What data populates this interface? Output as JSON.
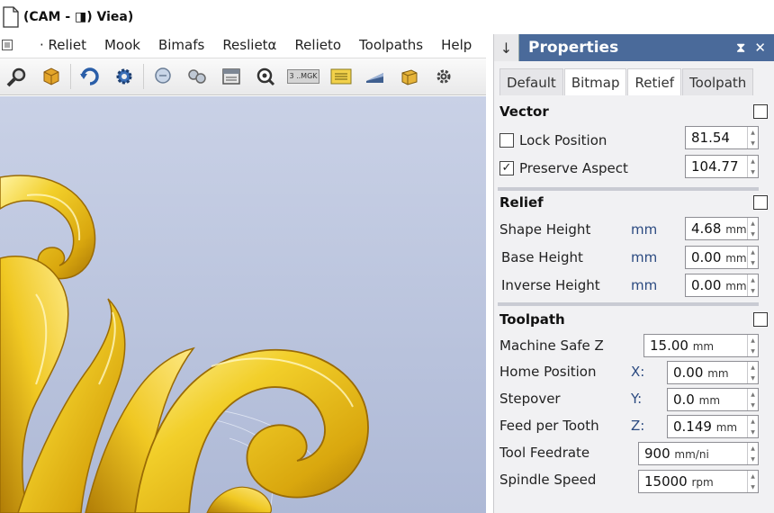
{
  "window": {
    "title": "(CAM - ◨) Viea)"
  },
  "menu": {
    "items": [
      "· Reliet",
      "Mook",
      "Bimafs",
      "Reslietα",
      "Relieto",
      "Toolpaths",
      "Help"
    ]
  },
  "toolbar": {
    "stamp_label": "3 ..MGK"
  },
  "panel": {
    "title": "Properties",
    "pin_glyph": "↓",
    "pin_ctrl": "⧗",
    "close_ctrl": "✕",
    "tabs": [
      "Default",
      "Bitmap",
      "Retief",
      "Toolpath"
    ],
    "vector": {
      "title": "Vector",
      "lock_label": "Lock Position",
      "lock_value": "81.54",
      "preserve_label": "Preserve Aspect",
      "preserve_check": "✓",
      "preserve_value": "104.77"
    },
    "relief": {
      "title": "Relief",
      "rows": [
        {
          "label": "Shape Height",
          "unit": "mm",
          "value": "4.68",
          "value_unit": "mm"
        },
        {
          "label": "Base Height",
          "unit": "mm",
          "value": "0.00",
          "value_unit": "mm"
        },
        {
          "label": "Inverse Height",
          "unit": "mm",
          "value": "0.00",
          "value_unit": "mm"
        }
      ]
    },
    "toolpath": {
      "title": "Toolpath",
      "rows": [
        {
          "label": "Machine Safe Z",
          "axis": "",
          "value": "15.00",
          "value_unit": "mm"
        },
        {
          "label": "Home Position",
          "axis": "X:",
          "value": "0.00",
          "value_unit": "mm"
        },
        {
          "label": "Stepover",
          "axis": "Y:",
          "value": "0.0",
          "value_unit": "mm"
        },
        {
          "label": "Feed per Tooth",
          "axis": "Z:",
          "value": "0.149",
          "value_unit": "mm"
        },
        {
          "label": "Tool Feedrate",
          "axis": "",
          "value": "900",
          "value_unit": "mm/ni"
        },
        {
          "label": "Spindle Speed",
          "axis": "",
          "value": "15000",
          "value_unit": "rpm"
        }
      ]
    }
  }
}
